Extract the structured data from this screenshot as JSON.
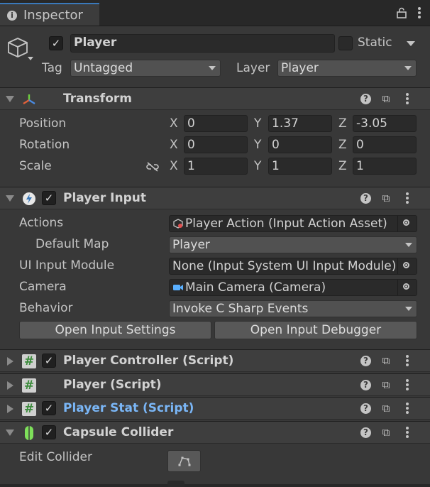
{
  "tab": {
    "title": "Inspector"
  },
  "header": {
    "object_name": "Player",
    "static_label": "Static",
    "tag_label": "Tag",
    "tag_value": "Untagged",
    "layer_label": "Layer",
    "layer_value": "Player"
  },
  "transform": {
    "title": "Transform",
    "axis_x": "X",
    "axis_y": "Y",
    "axis_z": "Z",
    "rows": [
      {
        "label": "Position",
        "x": "0",
        "y": "1.37",
        "z": "-3.05"
      },
      {
        "label": "Rotation",
        "x": "0",
        "y": "0",
        "z": "0"
      },
      {
        "label": "Scale",
        "x": "1",
        "y": "1",
        "z": "1"
      }
    ]
  },
  "player_input": {
    "title": "Player Input",
    "actions_label": "Actions",
    "actions_value": "Player Action (Input Action Asset)",
    "default_map_label": "Default Map",
    "default_map_value": "Player",
    "ui_module_label": "UI Input Module",
    "ui_module_value": "None (Input System UI Input Module)",
    "camera_label": "Camera",
    "camera_value": "Main Camera (Camera)",
    "behavior_label": "Behavior",
    "behavior_value": "Invoke C Sharp Events",
    "btn_settings": "Open Input Settings",
    "btn_debugger": "Open Input Debugger"
  },
  "components": {
    "player_controller": "Player Controller (Script)",
    "player_script": "Player (Script)",
    "player_stat": "Player Stat (Script)",
    "capsule_collider": "Capsule Collider",
    "edit_collider_label": "Edit Collider"
  },
  "icons": {
    "tab": "info-icon",
    "gameobject": "cube-icon",
    "lock": "lock-icon",
    "menu": "kebab-icon",
    "help": "help-icon",
    "presets": "sliders-icon",
    "constrain": "link-broken-icon"
  },
  "colors": {
    "accent_blue": "#3a79bb",
    "highlight_text": "#7ab6f6"
  }
}
